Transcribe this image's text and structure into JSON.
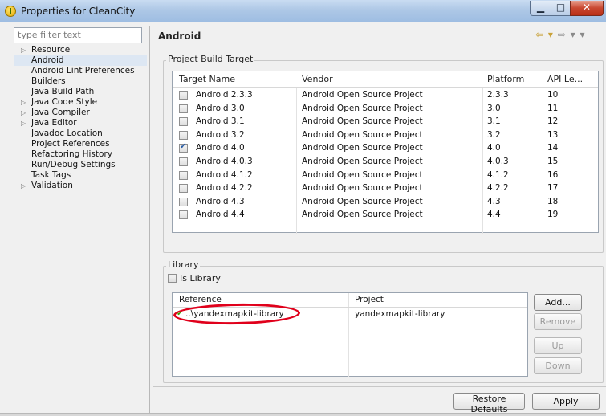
{
  "window": {
    "title": "Properties for CleanCity",
    "minimize_glyph": "▁",
    "maximize_glyph": "□",
    "close_glyph": "✕"
  },
  "sidebar": {
    "filter_placeholder": "type filter text",
    "items": [
      {
        "label": "Resource",
        "expandable": true,
        "selected": false
      },
      {
        "label": "Android",
        "expandable": false,
        "selected": true
      },
      {
        "label": "Android Lint Preferences",
        "expandable": false,
        "selected": false
      },
      {
        "label": "Builders",
        "expandable": false,
        "selected": false
      },
      {
        "label": "Java Build Path",
        "expandable": false,
        "selected": false
      },
      {
        "label": "Java Code Style",
        "expandable": true,
        "selected": false
      },
      {
        "label": "Java Compiler",
        "expandable": true,
        "selected": false
      },
      {
        "label": "Java Editor",
        "expandable": true,
        "selected": false
      },
      {
        "label": "Javadoc Location",
        "expandable": false,
        "selected": false
      },
      {
        "label": "Project References",
        "expandable": false,
        "selected": false
      },
      {
        "label": "Refactoring History",
        "expandable": false,
        "selected": false
      },
      {
        "label": "Run/Debug Settings",
        "expandable": false,
        "selected": false
      },
      {
        "label": "Task Tags",
        "expandable": false,
        "selected": false
      },
      {
        "label": "Validation",
        "expandable": true,
        "selected": false
      }
    ]
  },
  "page": {
    "title": "Android",
    "nav_back": "⇦ ▾",
    "nav_forward": "⇨ ▾ ▾"
  },
  "build_target": {
    "group_label": "Project Build Target",
    "columns": [
      "Target Name",
      "Vendor",
      "Platform",
      "API Le..."
    ],
    "rows": [
      {
        "name": "Android 2.3.3",
        "vendor": "Android Open Source Project",
        "platform": "2.3.3",
        "api": "10",
        "checked": false
      },
      {
        "name": "Android 3.0",
        "vendor": "Android Open Source Project",
        "platform": "3.0",
        "api": "11",
        "checked": false
      },
      {
        "name": "Android 3.1",
        "vendor": "Android Open Source Project",
        "platform": "3.1",
        "api": "12",
        "checked": false
      },
      {
        "name": "Android 3.2",
        "vendor": "Android Open Source Project",
        "platform": "3.2",
        "api": "13",
        "checked": false
      },
      {
        "name": "Android 4.0",
        "vendor": "Android Open Source Project",
        "platform": "4.0",
        "api": "14",
        "checked": true
      },
      {
        "name": "Android 4.0.3",
        "vendor": "Android Open Source Project",
        "platform": "4.0.3",
        "api": "15",
        "checked": false
      },
      {
        "name": "Android 4.1.2",
        "vendor": "Android Open Source Project",
        "platform": "4.1.2",
        "api": "16",
        "checked": false
      },
      {
        "name": "Android 4.2.2",
        "vendor": "Android Open Source Project",
        "platform": "4.2.2",
        "api": "17",
        "checked": false
      },
      {
        "name": "Android 4.3",
        "vendor": "Android Open Source Project",
        "platform": "4.3",
        "api": "18",
        "checked": false
      },
      {
        "name": "Android 4.4",
        "vendor": "Android Open Source Project",
        "platform": "4.4",
        "api": "19",
        "checked": false
      }
    ]
  },
  "library": {
    "group_label": "Library",
    "is_library_label": "Is Library",
    "is_library_checked": false,
    "columns": [
      "Reference",
      "Project"
    ],
    "rows": [
      {
        "reference": "..\\yandexmapkit-library",
        "project": "yandexmapkit-library"
      }
    ],
    "buttons": {
      "add": "Add...",
      "remove": "Remove",
      "up": "Up",
      "down": "Down"
    }
  },
  "footer": {
    "restore_defaults": "Restore Defaults",
    "apply": "Apply"
  },
  "colors": {
    "annotation_oval": "#e0001b",
    "selection": "#dde7f3"
  }
}
